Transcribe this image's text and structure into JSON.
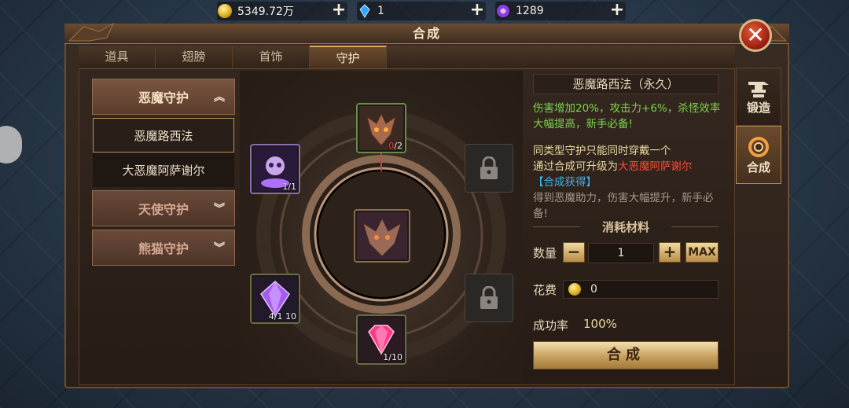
{
  "resources": [
    {
      "icon": "gold-coin-icon",
      "value": "5349.72万"
    },
    {
      "icon": "blue-diamond-icon",
      "value": "1"
    },
    {
      "icon": "purple-crystal-icon",
      "value": "1289"
    }
  ],
  "window": {
    "title": "合成"
  },
  "tabs": [
    "道具",
    "翅膀",
    "首饰",
    "守护"
  ],
  "active_tab": "守护",
  "categories": {
    "demon": "恶魔守护",
    "demon_items": [
      "恶魔路西法",
      "大恶魔阿萨谢尔"
    ],
    "angel": "天使守护",
    "panda": "熊猫守护"
  },
  "slots": {
    "top_count_have": "0",
    "top_count_need": "/2",
    "left_count": "1/1",
    "lower_left_count": "4/1 10",
    "bottom_count": "1/10"
  },
  "detail": {
    "title": "恶魔路西法（永久）",
    "effect": "伤害增加20%，攻击力+6%，杀怪效率大幅提高，新手必备!",
    "note_line1": "同类型守护只能同时穿戴一个",
    "note_line2_prefix": "通过合成可升级为",
    "note_line2_target": "大恶魔阿萨谢尔",
    "note_line3": "【合成获得】",
    "desc": "得到恶魔助力，伤害大幅提升，新手必备!"
  },
  "materials": {
    "title": "消耗材料",
    "quantity_label": "数量",
    "quantity_value": "1",
    "minus": "−",
    "plus": "+",
    "max": "MAX",
    "cost_label": "花费",
    "cost_value": "0",
    "success_label": "成功率",
    "success_value": "100%"
  },
  "combine_button": "合成",
  "side_tabs": [
    "锻造",
    "合成"
  ],
  "colors": {
    "effect_text": "#7cd34a",
    "upgrade_target": "#ff4a3a",
    "obtain_link": "#3fb6e8",
    "accent_gold": "#d8a860"
  }
}
